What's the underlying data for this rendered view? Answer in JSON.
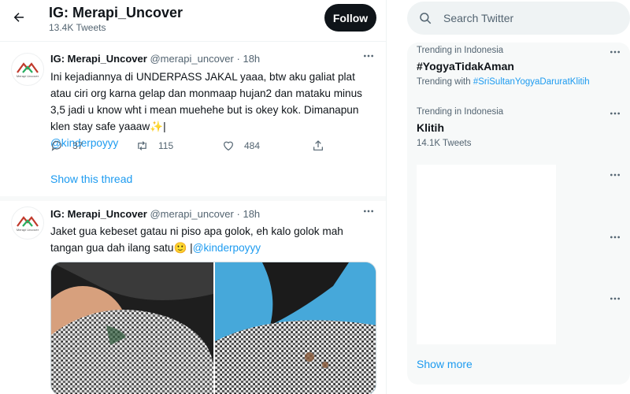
{
  "header": {
    "title": "IG: Merapi_Uncover",
    "subtitle": "13.4K Tweets",
    "follow_label": "Follow"
  },
  "tweets": [
    {
      "name": "IG: Merapi_Uncover",
      "handle": "@merapi_uncover",
      "dot": "·",
      "time": "18h",
      "avatar_text": "Merapi Uncover",
      "body": "Ini kejadiannya di UNDERPASS JAKAL yaaa, btw aku galiat plat atau ciri org karna gelap dan monmaap hujan2 dan mataku minus 3,5 jadi u know wht i mean muehehe but is okey kok. Dimanapun klen stay safe yaaaw✨|",
      "mention": "@kinderpoyyy",
      "replies": "37",
      "retweets": "115",
      "likes": "484",
      "show_thread": "Show this thread"
    },
    {
      "name": "IG: Merapi_Uncover",
      "handle": "@merapi_uncover",
      "dot": "·",
      "time": "18h",
      "avatar_text": "Merapi Uncover",
      "body": "Jaket gua kebeset gatau ni piso apa golok, eh kalo golok mah tangan gua dah ilang satu🙂 |",
      "mention": "@kinderpoyyy"
    }
  ],
  "sidebar": {
    "search_placeholder": "Search Twitter",
    "trends": [
      {
        "context": "Trending in Indonesia",
        "name": "#YogyaTidakAman",
        "sub_prefix": "Trending with ",
        "sub_tag": "#SriSultanYogyaDaruratKlitih"
      },
      {
        "context": "Trending in Indonesia",
        "name": "Klitih",
        "sub_text": "14.1K Tweets"
      }
    ],
    "show_more": "Show more"
  },
  "icons": {
    "back": "arrow-left-icon",
    "more": "more-horizontal-icon",
    "reply": "reply-icon",
    "retweet": "retweet-icon",
    "like": "heart-icon",
    "share": "share-icon",
    "search": "search-icon"
  },
  "colors": {
    "accent": "#1d9bf0",
    "text_primary": "#0f1419",
    "text_secondary": "#536471",
    "button_dark": "#0f1419"
  }
}
